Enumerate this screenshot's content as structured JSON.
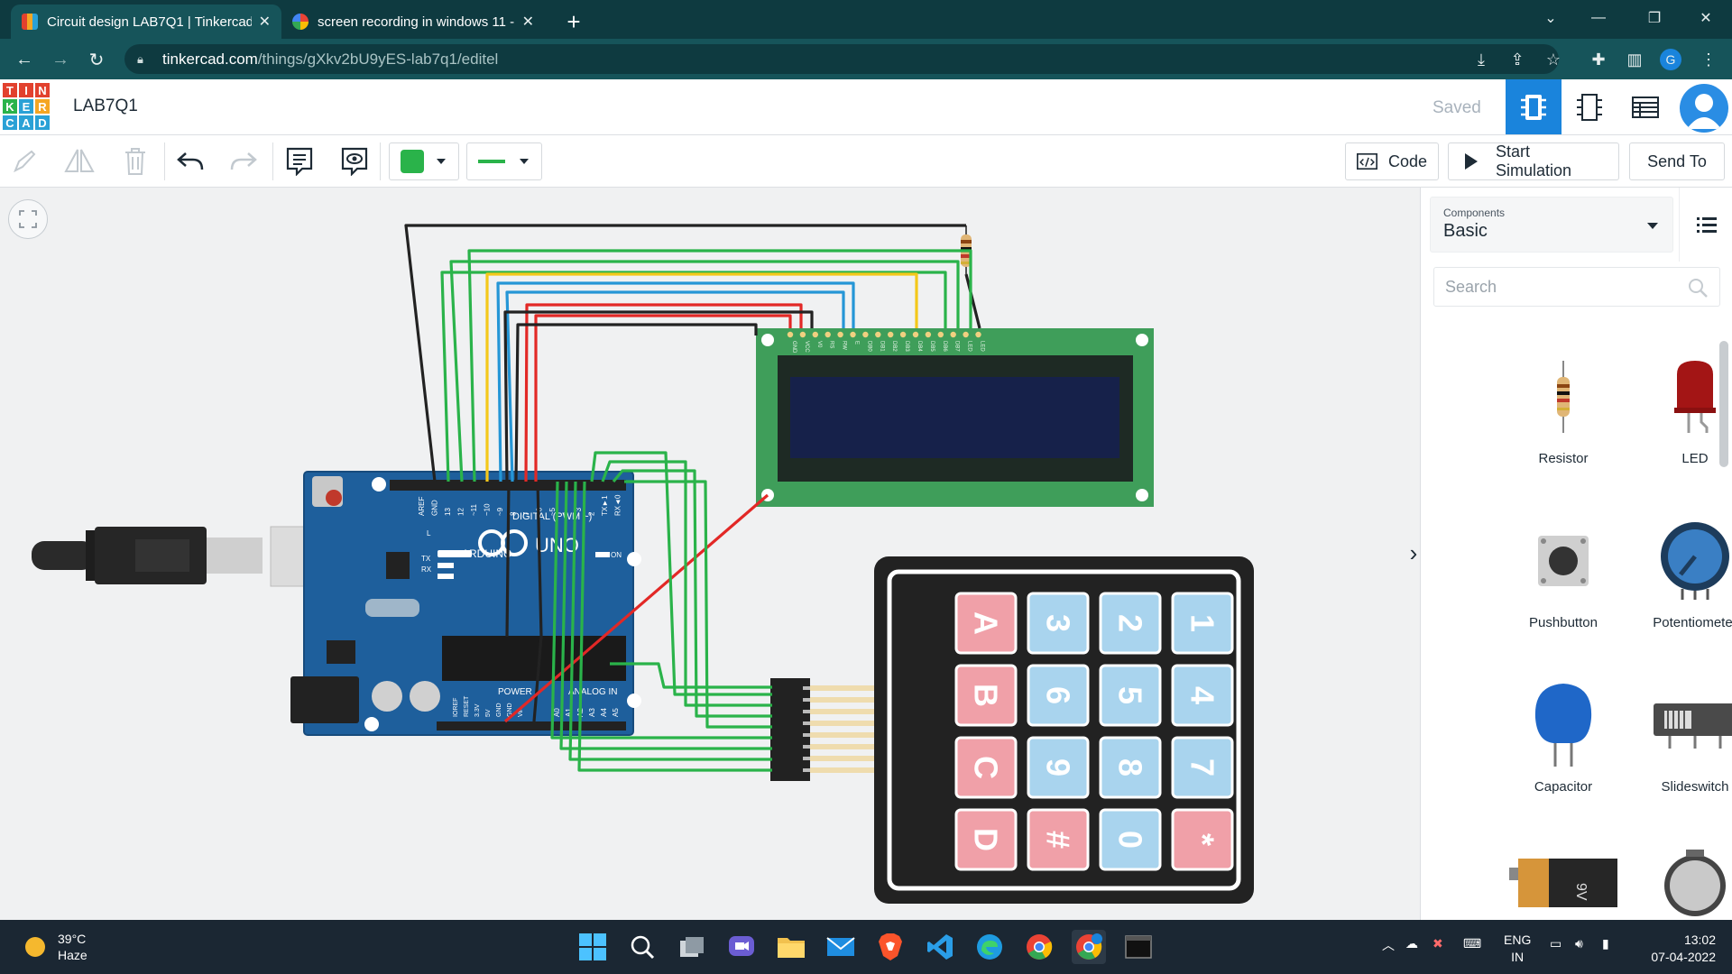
{
  "browser": {
    "tabs": [
      {
        "title": "Circuit design LAB7Q1 | Tinkercad",
        "active": true
      },
      {
        "title": "screen recording in windows 11 -",
        "active": false
      }
    ],
    "new_tab_label": "+",
    "url_host": "tinkercad.com",
    "url_path": "/things/gXkv2bU9yES-lab7q1/editel"
  },
  "header": {
    "logo_letters": [
      "T",
      "I",
      "N",
      "K",
      "E",
      "R",
      "C",
      "A",
      "D"
    ],
    "design_title": "LAB7Q1",
    "save_status": "Saved"
  },
  "toolbar": {
    "code_label": "Code",
    "start_simulation_label": "Start Simulation",
    "send_to_label": "Send To",
    "fill_color": "#2ab34a",
    "wire_color": "#2ab34a"
  },
  "canvas": {
    "lcd_pin_labels": [
      "GND",
      "VCC",
      "V0",
      "RS",
      "RW",
      "E",
      "DB0",
      "DB1",
      "DB2",
      "DB3",
      "DB4",
      "DB5",
      "DB6",
      "DB7",
      "LED",
      "LED"
    ],
    "arduino": {
      "brand": "ARDUINO",
      "model": "UNO",
      "digital_label": "DIGITAL (PWM ~)",
      "analog_label": "ANALOG IN",
      "power_label": "POWER",
      "on_label": "ON",
      "tx_label": "TX",
      "rx_label": "RX",
      "l_label": "L",
      "header_labels": [
        "AREF",
        "GND",
        "13",
        "12",
        "~11",
        "~10",
        "~9",
        "8",
        "7",
        "~6",
        "~5",
        "4",
        "~3",
        "2",
        "TX►1",
        "RX◄0"
      ],
      "analog_pins": [
        "A0",
        "A1",
        "A2",
        "A3",
        "A4",
        "A5"
      ],
      "power_pins": [
        "IOREF",
        "RESET",
        "3.3V",
        "5V",
        "GND",
        "GND",
        "Vin"
      ]
    },
    "keypad_keys": [
      [
        "1",
        "4",
        "7",
        "*"
      ],
      [
        "2",
        "5",
        "8",
        "0"
      ],
      [
        "3",
        "6",
        "9",
        "#"
      ],
      [
        "A",
        "B",
        "C",
        "D"
      ]
    ]
  },
  "panel": {
    "components_label": "Components",
    "components_value": "Basic",
    "search_placeholder": "Search",
    "items": [
      {
        "name": "Resistor"
      },
      {
        "name": "LED"
      },
      {
        "name": "Pushbutton"
      },
      {
        "name": "Potentiometer"
      },
      {
        "name": "Capacitor"
      },
      {
        "name": "Slideswitch"
      }
    ],
    "battery_label": "9V"
  },
  "taskbar": {
    "temperature": "39°C",
    "condition": "Haze",
    "lang_line1": "ENG",
    "lang_line2": "IN",
    "time": "13:02",
    "date": "07-04-2022"
  },
  "colors": {
    "tab_strip": "#0e3a40",
    "address_bar": "#16545a",
    "accent_blue": "#1a84dc",
    "arduino_blue": "#1e5f9c",
    "lcd_green": "#3f9e5a",
    "wire_green": "#2ab34a",
    "wire_red": "#e22826",
    "wire_yellow": "#f4c81a",
    "wire_blue": "#2596d6",
    "keypad_blue": "#a9d4ee",
    "keypad_red": "#f0a0a8"
  }
}
